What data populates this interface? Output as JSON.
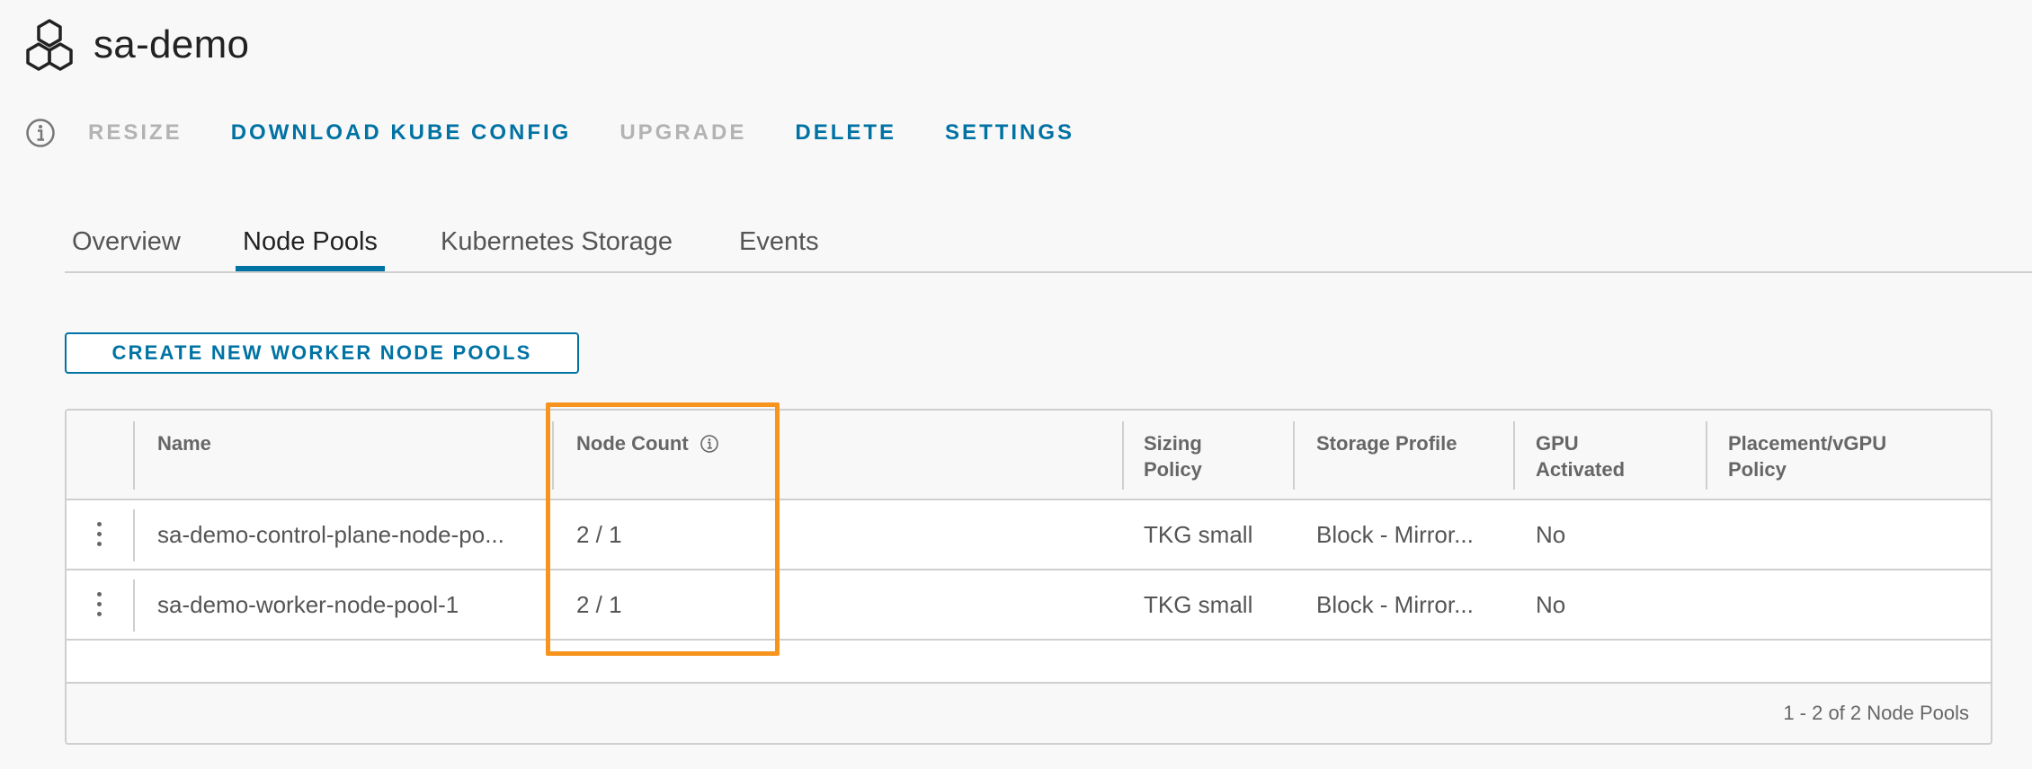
{
  "header": {
    "title": "sa-demo",
    "logo_icon": "hexagon-cluster-icon"
  },
  "actions": {
    "info_icon": "info-icon",
    "resize": "RESIZE",
    "download_kube_config": "DOWNLOAD KUBE CONFIG",
    "upgrade": "UPGRADE",
    "delete": "DELETE",
    "settings": "SETTINGS"
  },
  "tabs": [
    {
      "label": "Overview",
      "active": false
    },
    {
      "label": "Node Pools",
      "active": true
    },
    {
      "label": "Kubernetes Storage",
      "active": false
    },
    {
      "label": "Events",
      "active": false
    }
  ],
  "create_button": "CREATE NEW WORKER NODE POOLS",
  "table": {
    "columns": {
      "name": "Name",
      "node_count": "Node Count",
      "sizing_policy_1": "Sizing",
      "sizing_policy_2": "Policy",
      "storage_profile": "Storage Profile",
      "gpu_1": "GPU",
      "gpu_2": "Activated",
      "placement_1": "Placement/vGPU",
      "placement_2": "Policy"
    },
    "rows": [
      {
        "name": "sa-demo-control-plane-node-po...",
        "node_count": "2 / 1",
        "sizing_policy": "TKG small",
        "storage_profile": "Block - Mirror...",
        "gpu_activated": "No",
        "placement": ""
      },
      {
        "name": "sa-demo-worker-node-pool-1",
        "node_count": "2 / 1",
        "sizing_policy": "TKG small",
        "storage_profile": "Block - Mirror...",
        "gpu_activated": "No",
        "placement": ""
      }
    ],
    "footer": "1 - 2 of 2 Node Pools"
  },
  "colors": {
    "accent": "#0072a3",
    "highlight": "#f7941d",
    "disabled": "#b3b3b3"
  }
}
